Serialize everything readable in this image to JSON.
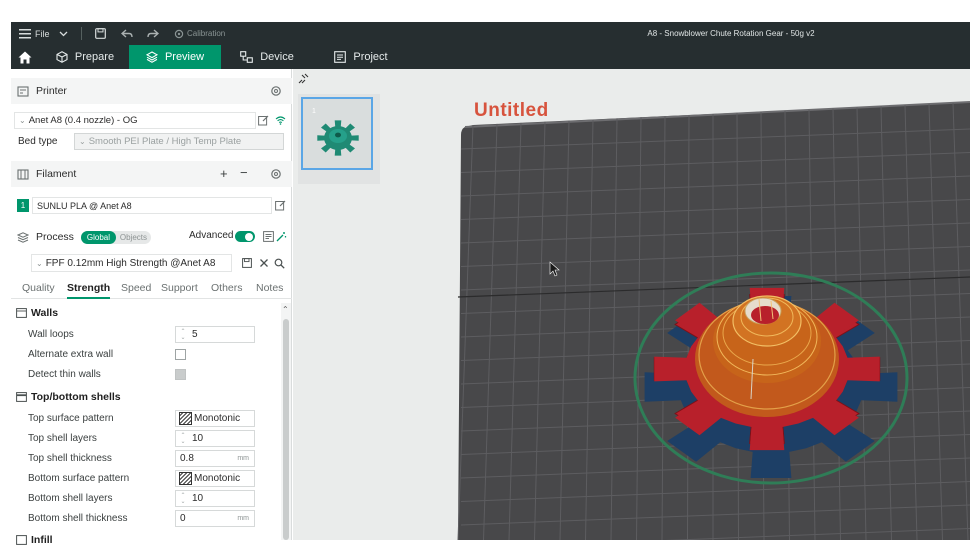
{
  "titlebar": {
    "file_label": "File",
    "calibration_label": "Calibration",
    "window_title": "A8 - Snowblower Chute Rotation Gear - 50g v2"
  },
  "nav": {
    "tabs": [
      {
        "label": "Prepare",
        "icon": "cube-icon"
      },
      {
        "label": "Preview",
        "icon": "layers-icon",
        "active": true
      },
      {
        "label": "Device",
        "icon": "device-icon"
      },
      {
        "label": "Project",
        "icon": "project-icon"
      }
    ]
  },
  "printer": {
    "section_label": "Printer",
    "selected": "Anet A8 (0.4 nozzle) - OG",
    "bed_type_label": "Bed type",
    "bed_type_value": "Smooth PEI Plate / High Temp Plate"
  },
  "filament": {
    "section_label": "Filament",
    "slot_number": "1",
    "selected": "SUNLU PLA @ Anet A8",
    "slot_color": "#00966c"
  },
  "process": {
    "section_label": "Process",
    "global_label": "Global",
    "objects_label": "Objects",
    "advanced_label": "Advanced",
    "advanced_enabled": true,
    "preset": "FPF 0.12mm High Strength @Anet A8",
    "tabs": [
      "Quality",
      "Strength",
      "Speed",
      "Support",
      "Others",
      "Notes"
    ],
    "active_tab": "Strength"
  },
  "walls": {
    "title": "Walls",
    "wall_loops_label": "Wall loops",
    "wall_loops_value": "5",
    "alternate_extra_wall_label": "Alternate extra wall",
    "detect_thin_walls_label": "Detect thin walls"
  },
  "top_bottom": {
    "title": "Top/bottom shells",
    "top_surface_pattern_label": "Top surface pattern",
    "top_surface_pattern_value": "Monotonic",
    "top_shell_layers_label": "Top shell layers",
    "top_shell_layers_value": "10",
    "top_shell_thickness_label": "Top shell thickness",
    "top_shell_thickness_value": "0.8",
    "bottom_surface_pattern_label": "Bottom surface pattern",
    "bottom_surface_pattern_value": "Monotonic",
    "bottom_shell_layers_label": "Bottom shell layers",
    "bottom_shell_layers_value": "10",
    "bottom_shell_thickness_label": "Bottom shell thickness",
    "bottom_shell_thickness_value": "0",
    "unit": "mm"
  },
  "infill": {
    "title": "Infill"
  },
  "viewport": {
    "plate_thumb_number": "1",
    "plate_name": "Untitled"
  },
  "colors": {
    "accent": "#00966c",
    "titlebar_bg": "#262e30",
    "plate_title": "#d7533d",
    "gear_red": "#b8202b",
    "gear_orange": "#c7641a",
    "brim_blue": "#1d3f66",
    "skirt_green": "#2f7d57"
  }
}
